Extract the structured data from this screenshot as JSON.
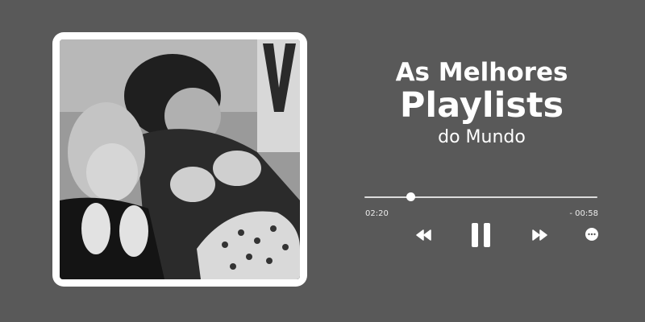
{
  "player": {
    "title_line1": "As Melhores",
    "title_line2": "Playlists",
    "title_line3": "do Mundo",
    "time_elapsed": "02:20",
    "time_remaining": "- 00:58",
    "progress_fraction": 0.2
  },
  "cover": {
    "description_icon": "album-cover-photo"
  },
  "controls": {
    "rewind_icon": "rewind-icon",
    "pause_icon": "pause-icon",
    "forward_icon": "fast-forward-icon",
    "more_icon": "more-options-icon"
  },
  "colors": {
    "background": "#595959",
    "accent": "#ffffff"
  }
}
